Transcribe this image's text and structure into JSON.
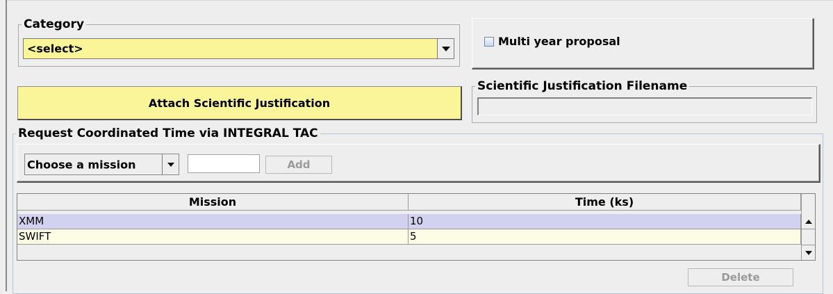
{
  "category": {
    "legend": "Category",
    "selected": "<select>"
  },
  "multi_year": {
    "label": "Multi year proposal",
    "checked": false
  },
  "attach": {
    "label": "Attach Scientific Justification"
  },
  "sci_filename": {
    "legend": "Scientific Justification Filename",
    "value": ""
  },
  "coordinated": {
    "legend": "Request Coordinated Time via INTEGRAL TAC",
    "mission_select": "Choose a mission",
    "time_value": "",
    "add_label": "Add",
    "columns": [
      "Mission",
      "Time (ks)"
    ],
    "rows": [
      {
        "mission": "XMM",
        "time": "10"
      },
      {
        "mission": "SWIFT",
        "time": "5"
      }
    ],
    "delete_label": "Delete"
  },
  "colors": {
    "required_field": "#fbf59a",
    "selected_row": "#d2d2f0",
    "row_alt": "#fcfce4",
    "background": "#eeeeee"
  }
}
